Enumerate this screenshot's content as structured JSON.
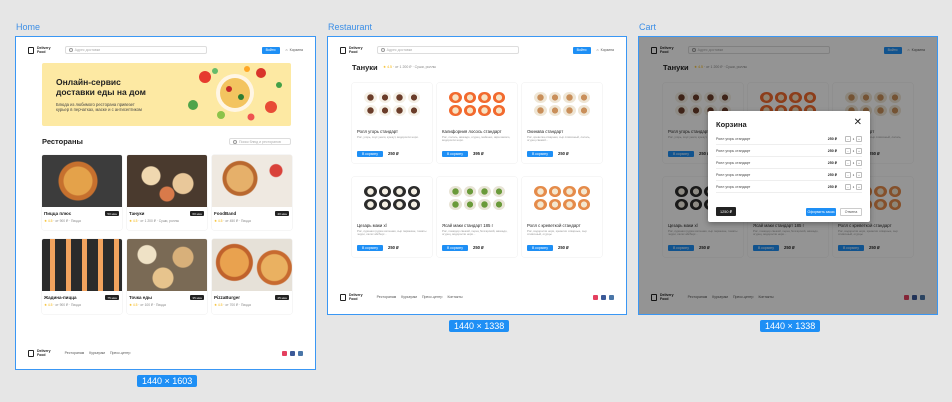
{
  "frames": [
    {
      "label": "Home",
      "size": "1440 × 1603"
    },
    {
      "label": "Restaurant",
      "size": "1440 × 1338"
    },
    {
      "label": "Cart",
      "size": "1440 × 1338"
    }
  ],
  "logo": {
    "text": "Delivery\nFood"
  },
  "header": {
    "search_placeholder": "Адрес доставки",
    "login_label": "Войти",
    "cart_label": "Корзина"
  },
  "home": {
    "banner_title": "Онлайн-сервис\nдоставки еды на дом",
    "banner_text": "Блюда из любимого ресторана привезет курьер в перчатках, маске и с антисептиком",
    "section_title": "Рестораны",
    "section_search_placeholder": "Поиск блюд и ресторанов",
    "restaurants": [
      {
        "name": "Пицца плюс",
        "tag": "50 мин",
        "rating": "★ 4.5",
        "meta": "· от 900 ₽ · Пицца"
      },
      {
        "name": "Тануки",
        "tag": "60 мин",
        "rating": "★ 4.5",
        "meta": "· от 1 200 ₽ · Суши, роллы"
      },
      {
        "name": "FoodBand",
        "tag": "40 мин",
        "rating": "★ 4.5",
        "meta": "· от 450 ₽ · Пицца"
      },
      {
        "name": "Жадина-пицца",
        "tag": "75 мин",
        "rating": "★ 4.5",
        "meta": "· от 900 ₽ · Пицца"
      },
      {
        "name": "Точка еды",
        "tag": "35 мин",
        "rating": "★ 4.5",
        "meta": "· от 100 ₽ · Пицца"
      },
      {
        "name": "PizzaBurger",
        "tag": "45 мин",
        "rating": "★ 4.5",
        "meta": "· от 700 ₽ · Пицца"
      }
    ],
    "footer_links": [
      "Ресторанам",
      "Курьерам",
      "Пресс-центр"
    ]
  },
  "restaurant": {
    "title": "Тануки",
    "rating": "★ 4.5",
    "meta": "· от 1 200 ₽ · Суши, роллы",
    "add_label": "В корзину",
    "products": [
      {
        "name": "Ролл угорь стандарт",
        "desc": "Рис, угорь, соус унаги, кунжут, водоросли нори.",
        "price": "250 ₽"
      },
      {
        "name": "Калифорния лосось стандарт",
        "desc": "Рис, лосось, авокадо, огурец, майонез, икра масаго, водоросли нори.",
        "price": "395 ₽"
      },
      {
        "name": "Окинава стандарт",
        "desc": "Рис, креветка отварная, сыр сливочный, лосось, огурец свежий...",
        "price": "250 ₽"
      },
      {
        "name": "Цезарь маки хl",
        "desc": "Рис, куриная грудка копченая, сыр пармезан, томаты черри, салат айсберг...",
        "price": "250 ₽"
      },
      {
        "name": "Ясай маки стандарт 185 г",
        "desc": "Рис, помидор свежий, перец болгарский, авокадо, огурец, водоросли нори...",
        "price": "250 ₽"
      },
      {
        "name": "Ролл с креветкой стандарт",
        "desc": "Рис, водоросли нори, креветки отварные, сыр сливочный, огурцы",
        "price": "250 ₽"
      }
    ],
    "footer_links": [
      "Ресторанам",
      "Курьерам",
      "Пресс-центр",
      "Контакты"
    ]
  },
  "cart": {
    "title": "Корзина",
    "items": [
      {
        "name": "Ролл угорь стандарт",
        "price": "250 ₽",
        "qty": "1"
      },
      {
        "name": "Ролл угорь стандарт",
        "price": "250 ₽",
        "qty": "1"
      },
      {
        "name": "Ролл угорь стандарт",
        "price": "250 ₽",
        "qty": "1"
      },
      {
        "name": "Ролл угорь стандарт",
        "price": "250 ₽",
        "qty": "1"
      },
      {
        "name": "Ролл угорь стандарт",
        "price": "250 ₽",
        "qty": "1"
      }
    ],
    "total": "1250 ₽",
    "checkout_label": "Оформить заказ",
    "cancel_label": "Отмена"
  },
  "colors": {
    "accent": "#1e8ff5",
    "frame_border": "#3a97f4",
    "banner": "#fde9a3",
    "star": "#f5b50a"
  }
}
